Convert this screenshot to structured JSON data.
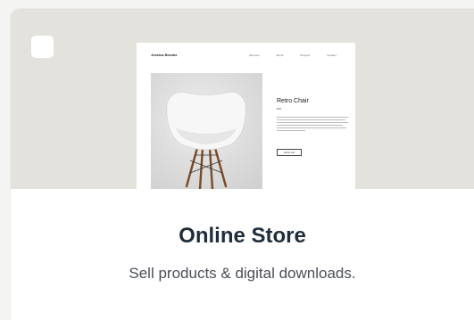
{
  "template": {
    "name": "Online Store",
    "description": "Sell products & digital downloads.",
    "selected": false
  },
  "preview": {
    "brand": "Jessica Brooks",
    "nav_items": [
      "Services",
      "About",
      "Projects",
      "Contact"
    ],
    "product_title": "Retro Chair",
    "product_price": "$38",
    "button_label": "Add to cart"
  },
  "colors": {
    "preview_bg": "#e3e2dd",
    "card_bg": "#ffffff",
    "title": "#1f2d3a",
    "subtitle": "#4a4f57"
  }
}
